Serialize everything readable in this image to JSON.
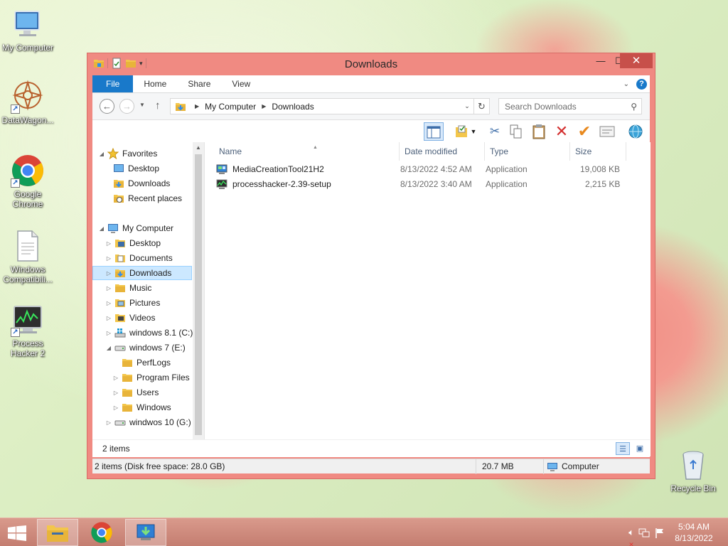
{
  "desktop": {
    "icons": [
      {
        "label": "My Computer"
      },
      {
        "label": "DataWagon..."
      },
      {
        "label": "Google Chrome"
      },
      {
        "label": "Windows Compatibili..."
      },
      {
        "label": "Process Hacker 2"
      },
      {
        "label": "Recycle Bin"
      }
    ]
  },
  "window": {
    "title": "Downloads",
    "ribbon_tabs": [
      "File",
      "Home",
      "Share",
      "View"
    ],
    "address": {
      "crumbs": [
        "My Computer",
        "Downloads"
      ]
    },
    "search": {
      "placeholder": "Search Downloads"
    },
    "nav_tree": {
      "favorites_header": "Favorites",
      "favorites": [
        "Desktop",
        "Downloads",
        "Recent places"
      ],
      "computer_header": "My Computer",
      "computer_items": [
        "Desktop",
        "Documents",
        "Downloads",
        "Music",
        "Pictures",
        "Videos",
        "windows 8.1 (C:)",
        "windows 7 (E:)"
      ],
      "e_children": [
        "PerfLogs",
        "Program Files",
        "Users",
        "Windows"
      ],
      "last_drive": "windwos 10 (G:)",
      "selected": "Downloads"
    },
    "columns": [
      "Name",
      "Date modified",
      "Type",
      "Size"
    ],
    "files": [
      {
        "name": "MediaCreationTool21H2",
        "date": "8/13/2022 4:52 AM",
        "type": "Application",
        "size": "19,008 KB"
      },
      {
        "name": "processhacker-2.39-setup",
        "date": "8/13/2022 3:40 AM",
        "type": "Application",
        "size": "2,215 KB"
      }
    ],
    "item_count": "2 items",
    "statusbar": {
      "summary": "2 items (Disk free space: 28.0 GB)",
      "size": "20.7 MB",
      "location": "Computer"
    }
  },
  "taskbar": {
    "clock_time": "5:04 AM",
    "clock_date": "8/13/2022"
  },
  "colors": {
    "window_frame": "#f08a82",
    "file_tab": "#1979ca",
    "selection": "#cce8ff",
    "taskbar": "#c47d70"
  }
}
